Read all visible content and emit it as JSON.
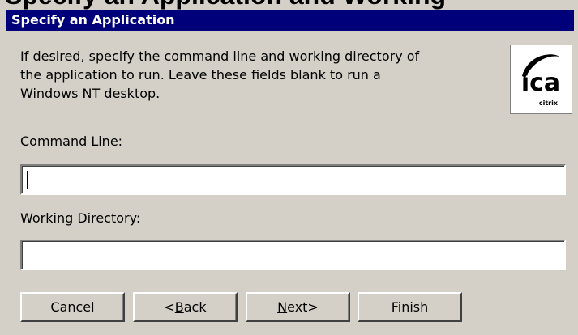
{
  "page": {
    "heading": "Specify an Application and Working"
  },
  "dialog": {
    "title": "Specify an Application",
    "instructions": [
      "If desired, specify the command line and working directory of",
      "the application to run. Leave these fields blank to run a",
      "Windows NT desktop."
    ],
    "logo": {
      "icon": "ica-citrix-logo",
      "wordmark": "ica",
      "brand": "citrix"
    }
  },
  "form": {
    "command_line": {
      "label": "Command Line:",
      "value": ""
    },
    "working_directory": {
      "label": "Working Directory:",
      "value": ""
    }
  },
  "buttons": {
    "cancel": {
      "label": "Cancel"
    },
    "back": {
      "prefix": "<",
      "mnemonic": "B",
      "rest": "ack"
    },
    "next": {
      "mnemonic": "N",
      "rest": "ext>"
    },
    "finish": {
      "label": "Finish"
    }
  },
  "colors": {
    "title_bar": "#00007a",
    "face": "#d4d0c8",
    "field": "#ffffff"
  }
}
